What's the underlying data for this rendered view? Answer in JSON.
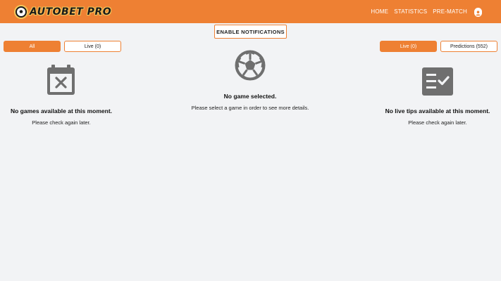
{
  "header": {
    "logo_text": "AUTOBET PRO",
    "nav": [
      "HOME",
      "STATISTICS",
      "PRE-MATCH"
    ],
    "account_icon": "account-circle-icon"
  },
  "notifications": {
    "button_label": "ENABLE NOTIFICATIONS"
  },
  "left_panel": {
    "tabs": [
      {
        "label": "All",
        "active": true
      },
      {
        "label": "Live (0)",
        "active": false
      }
    ],
    "icon": "calendar-x-icon",
    "title": "No games available at this moment.",
    "subtitle": "Please check again later."
  },
  "center_panel": {
    "icon": "soccer-ball-icon",
    "title": "No game selected.",
    "subtitle": "Please select a game in order to see more details."
  },
  "right_panel": {
    "tabs": [
      {
        "label": "Live (0)",
        "active": true
      },
      {
        "label": "Predictions (552)",
        "active": false
      }
    ],
    "icon": "checklist-icon",
    "title": "No live tips available at this moment.",
    "subtitle": "Please check again later."
  },
  "colors": {
    "accent": "#ee8033",
    "background": "#f2f3f5",
    "icon_gray": "#6f6f6f"
  }
}
